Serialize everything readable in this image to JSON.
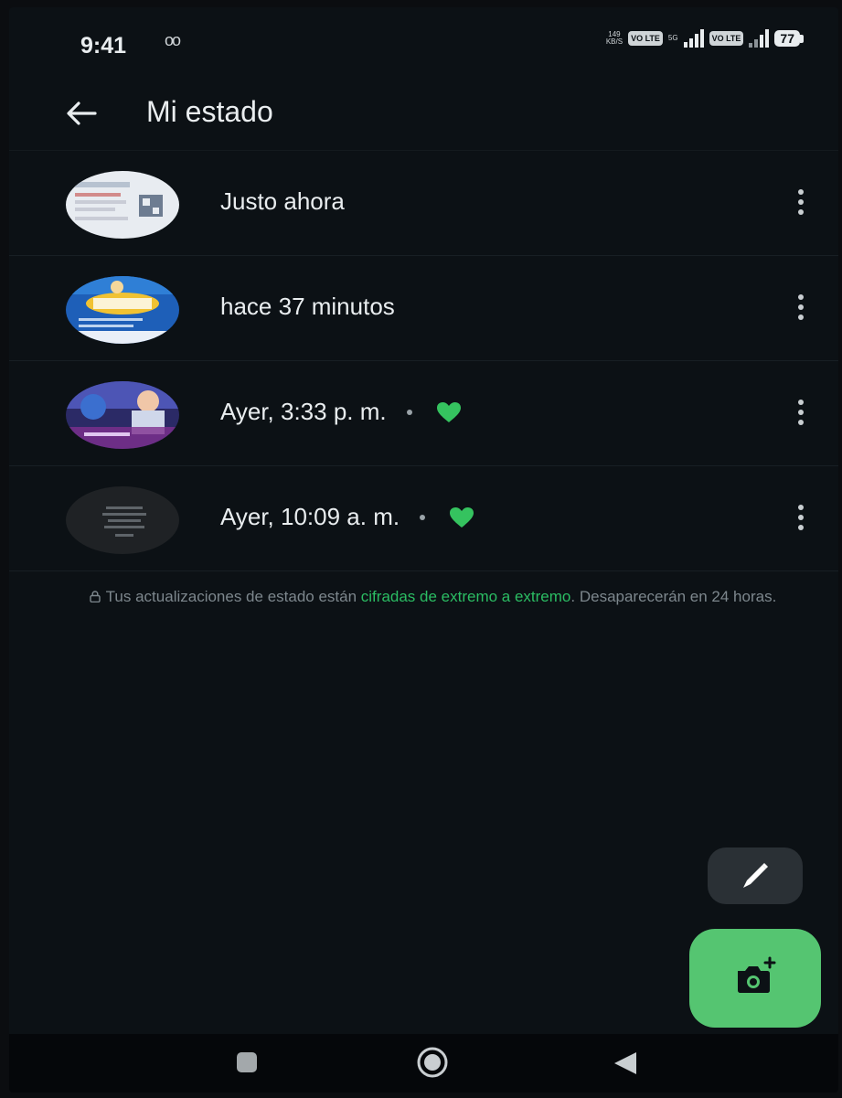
{
  "status_bar": {
    "time": "9:41",
    "voicemail_glyph": "oo",
    "data_speed_top": "149",
    "data_speed_unit": "KB/S",
    "sim1_tag": "VO LTE",
    "network_type": "5G",
    "sim2_tag": "VO LTE",
    "battery": "77"
  },
  "header": {
    "title": "Mi estado",
    "back_icon": "arrow-left-icon"
  },
  "status_updates": [
    {
      "time_label": "Justo ahora",
      "has_reaction": false,
      "thumb_theme": "light-document"
    },
    {
      "time_label": "hace 37 minutos",
      "has_reaction": false,
      "thumb_theme": "blue-banner"
    },
    {
      "time_label": "Ayer, 3:33 p. m.",
      "has_reaction": true,
      "thumb_theme": "photo-people"
    },
    {
      "time_label": "Ayer, 10:09 a. m.",
      "has_reaction": true,
      "thumb_theme": "dark-text"
    }
  ],
  "notice": {
    "prefix": "Tus actualizaciones de estado están ",
    "link_text": "cifradas de extremo a extremo",
    "suffix": ". Desaparecerán en 24 horas."
  },
  "fabs": {
    "pencil_icon": "pencil-icon",
    "camera_icon": "camera-add-icon"
  },
  "nav_bar": {
    "recents_icon": "square-icon",
    "home_icon": "circle-home-icon",
    "back_icon": "triangle-back-icon"
  },
  "colors": {
    "background": "#0c1115",
    "accent_green": "#55c571",
    "link_green": "#2bbd63",
    "reaction_heart": "#35c35f",
    "text_primary": "#e9edef",
    "text_muted": "#7d878d"
  }
}
